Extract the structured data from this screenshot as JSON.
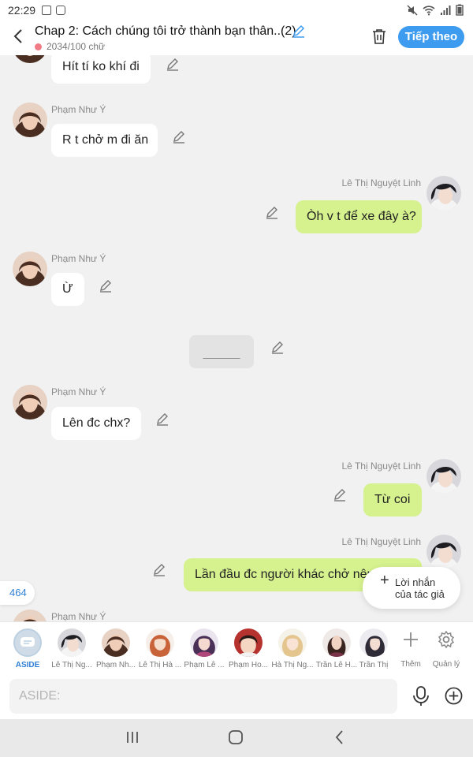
{
  "status": {
    "time": "22:29"
  },
  "header": {
    "title": "Chap 2: Cách chúng tôi trở thành bạn thân..(2)",
    "wordcount": "2034/100 chữ",
    "next_label": "Tiếp theo"
  },
  "colors": {
    "accent": "#3e9cf0",
    "bubble_right": "#d6f28e",
    "bubble_left": "#ffffff"
  },
  "messages": [
    {
      "side": "left",
      "text": "Hít tí ko khí đi"
    },
    {
      "side": "left",
      "sender": "Phạm Như Ý",
      "text": "R t chở m đi ăn"
    },
    {
      "side": "right",
      "sender": "Lê Thị Nguyệt Linh",
      "text": "Òh v t để xe đây à?"
    },
    {
      "side": "left",
      "sender": "Phạm Như Ý",
      "text": "Ừ"
    },
    {
      "side": "narration",
      "text": "______"
    },
    {
      "side": "left",
      "sender": "Phạm Như Ý",
      "text": "Lên đc chx?"
    },
    {
      "side": "right",
      "sender": "Lê Thị Nguyệt Linh",
      "text": "Từ coi"
    },
    {
      "side": "right",
      "sender": "Lê Thị Nguyệt Linh",
      "text": "Lần đầu đc người khác chở nên"
    },
    {
      "side": "left",
      "sender": "Phạm Như Ý"
    }
  ],
  "floating": {
    "count": "464",
    "author_note_line1": "Lời nhắn",
    "author_note_line2": "của tác giả"
  },
  "characters": [
    {
      "name": "ASIDE"
    },
    {
      "name": "Lê Thị Ng..."
    },
    {
      "name": "Phạm Nh..."
    },
    {
      "name": "Lê Thị Hà ..."
    },
    {
      "name": "Phạm Lê ..."
    },
    {
      "name": "Phạm Ho..."
    },
    {
      "name": "Hà Thị Ng..."
    },
    {
      "name": "Trần Lê H..."
    },
    {
      "name": "Trần Thị"
    }
  ],
  "tools": {
    "add_label": "Thêm",
    "manage_label": "Quản lý"
  },
  "input": {
    "placeholder": "ASIDE:"
  }
}
